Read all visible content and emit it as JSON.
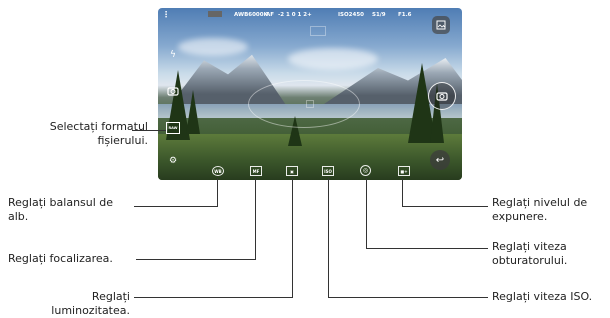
{
  "status_bar": {
    "awb": "AWB6000K",
    "af": "AF",
    "ev_scale": "-2  1  0  1  2+",
    "iso": "ISO2450",
    "shutter": "S1/9",
    "aperture": "F1.6"
  },
  "labels": {
    "file_format": "Selectați formatul fișierului.",
    "white_balance": "Reglați balansul de alb.",
    "focus": "Reglați focalizarea.",
    "brightness": "Reglați luminozitatea.",
    "exposure": "Reglați nivelul de expunere.",
    "shutter_speed": "Reglați viteza obturatorului.",
    "iso": "Reglați viteza ISO."
  },
  "bottom_controls": {
    "wb": "WB",
    "mf": "MF",
    "bright": "▣",
    "iso_ctrl": "ISO",
    "ev": "■+"
  },
  "icons": {
    "flash": "flash-off-icon",
    "rotate": "camera-switch-icon",
    "format": "raw-format-icon",
    "settings": "gear-icon",
    "gallery": "gallery-icon",
    "shutter": "camera-icon",
    "back": "back-icon"
  }
}
